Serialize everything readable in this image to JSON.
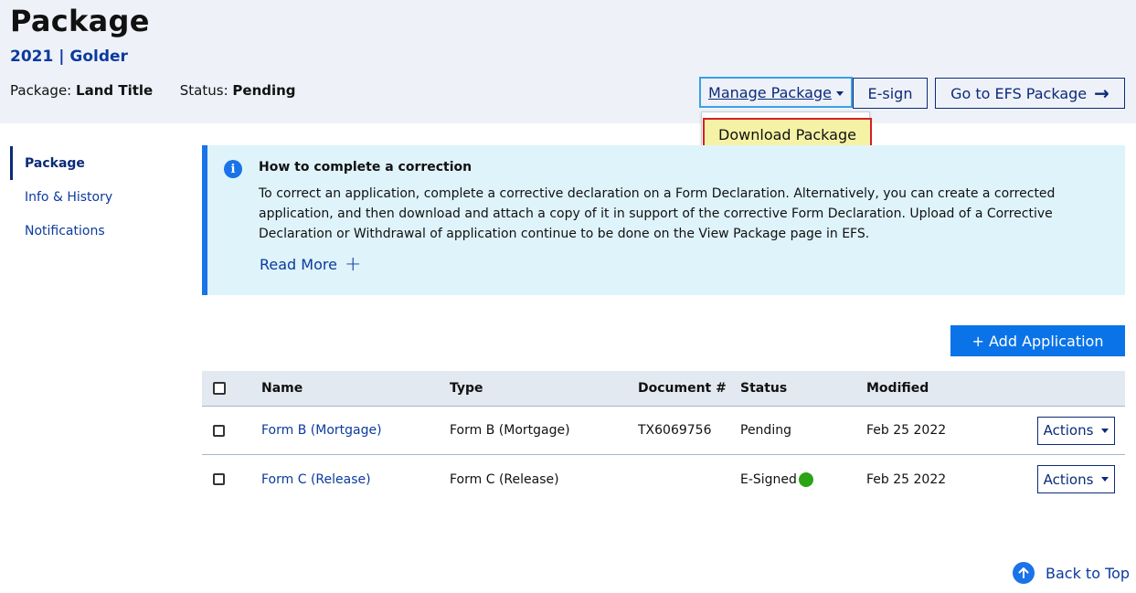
{
  "header": {
    "title": "Package",
    "subtitle": "2021 | Golder",
    "package_label": "Package:",
    "package_value": "Land Title",
    "status_label": "Status:",
    "status_value": "Pending"
  },
  "toolbar": {
    "manage_label": "Manage Package",
    "esign_label": "E-sign",
    "goto_label": "Go to EFS Package",
    "dropdown_item": "Download Package"
  },
  "sidenav": {
    "items": [
      {
        "label": "Package",
        "active": true
      },
      {
        "label": "Info & History",
        "active": false
      },
      {
        "label": "Notifications",
        "active": false
      }
    ]
  },
  "callout": {
    "title": "How to complete a correction",
    "body": "To correct an application, complete a corrective declaration on a Form Declaration. Alternatively, you can create a corrected application, and then download and attach a copy of it in support of the corrective Form Declaration. Upload of a Corrective Declaration or Withdrawal of application continue to be done on the View Package page in EFS.",
    "read_more": "Read More"
  },
  "add_button": "+ Add Application",
  "table": {
    "headers": {
      "name": "Name",
      "type": "Type",
      "document": "Document #",
      "status": "Status",
      "modified": "Modified"
    },
    "rows": [
      {
        "name": "Form B (Mortgage)",
        "type": "Form B (Mortgage)",
        "document": "TX6069756",
        "status": "Pending",
        "modified": "Feb 25 2022",
        "actions": "Actions"
      },
      {
        "name": "Form C (Release)",
        "type": "Form C (Release)",
        "document": "",
        "status": "E-Signed",
        "modified": "Feb 25 2022",
        "actions": "Actions"
      }
    ]
  },
  "back_to_top": "Back to Top",
  "colors": {
    "accent": "#1a73e8",
    "link": "#0b3a9e",
    "status_signed": "#2aa317",
    "highlight": "#f5f2a6"
  }
}
